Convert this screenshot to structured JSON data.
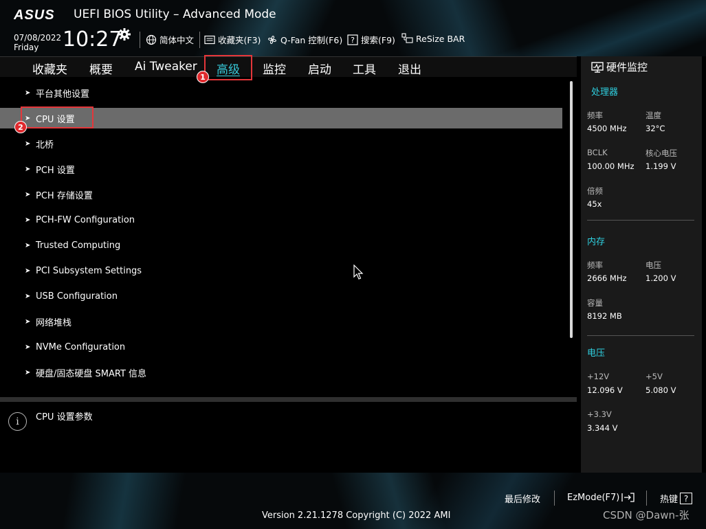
{
  "header": {
    "brand": "ASUS",
    "title": "UEFI BIOS Utility – Advanced Mode",
    "date": "07/08/2022",
    "weekday": "Friday",
    "time": "10:27",
    "tools": [
      {
        "icon": "globe-icon",
        "label": "简体中文"
      },
      {
        "icon": "bookmark-icon",
        "label": "收藏夹(F3)"
      },
      {
        "icon": "fan-icon",
        "label": "Q-Fan 控制(F6)"
      },
      {
        "icon": "help-icon",
        "label": "搜索(F9)"
      },
      {
        "icon": "resize-bar-icon",
        "label": "ReSize BAR"
      }
    ]
  },
  "nav": {
    "tabs": [
      "收藏夹",
      "概要",
      "Ai Tweaker",
      "高级",
      "监控",
      "启动",
      "工具",
      "退出"
    ],
    "active_index": 3
  },
  "annotations": {
    "marker1": "1",
    "marker2": "2",
    "highlight_color": "#e5363a"
  },
  "menu": {
    "items": [
      "平台其他设置",
      "CPU 设置",
      "北桥",
      "PCH 设置",
      "PCH 存储设置",
      "PCH-FW Configuration",
      "Trusted Computing",
      "PCI Subsystem Settings",
      "USB Configuration",
      "网络堆栈",
      "NVMe Configuration",
      "硬盘/固态硬盘 SMART 信息"
    ],
    "selected_index": 1
  },
  "help": {
    "text": "CPU 设置参数"
  },
  "monitor": {
    "title": "硬件监控",
    "cpu": {
      "section": "处理器",
      "freq_label": "频率",
      "freq_value": "4500 MHz",
      "temp_label": "温度",
      "temp_value": "32°C",
      "bclk_label": "BCLK",
      "bclk_value": "100.00 MHz",
      "vcore_label": "核心电压",
      "vcore_value": "1.199 V",
      "ratio_label": "倍频",
      "ratio_value": "45x"
    },
    "memory": {
      "section": "内存",
      "freq_label": "频率",
      "freq_value": "2666 MHz",
      "volt_label": "电压",
      "volt_value": "1.200 V",
      "cap_label": "容量",
      "cap_value": "8192 MB"
    },
    "voltage": {
      "section": "电压",
      "v12_label": "+12V",
      "v12_value": "12.096 V",
      "v5_label": "+5V",
      "v5_value": "5.080 V",
      "v33_label": "+3.3V",
      "v33_value": "3.344 V"
    }
  },
  "footer": {
    "last_modified": "最后修改",
    "ezmode": "EzMode(F7)",
    "hotkeys": "热键",
    "hotkey_symbol": "?",
    "version": "Version 2.21.1278 Copyright (C) 2022 AMI",
    "watermark": "CSDN @Dawn-张"
  },
  "colors": {
    "accent": "#37c8d8",
    "selected_row": "#6b6b6b",
    "monitor_bg": "#1a1a1a"
  }
}
